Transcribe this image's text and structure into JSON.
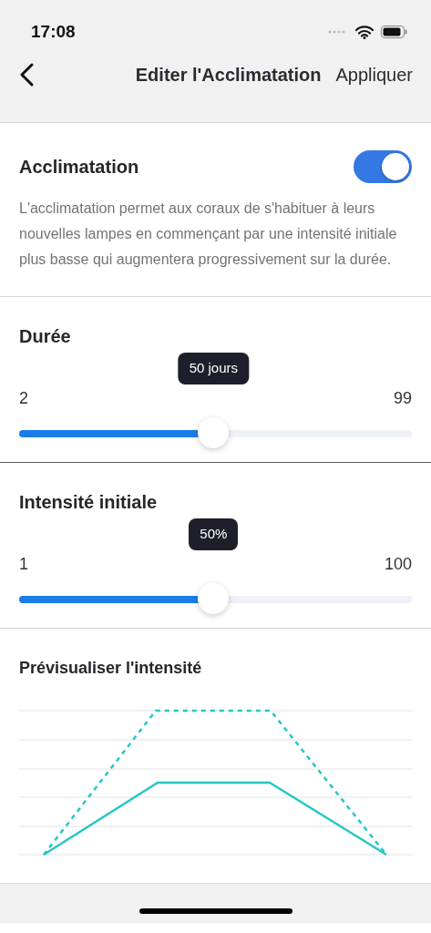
{
  "status_bar": {
    "time": "17:08"
  },
  "nav": {
    "title": "Editer l'Acclimatation",
    "action": "Appliquer"
  },
  "acclimatation": {
    "label": "Acclimatation",
    "on": true,
    "description": "L'acclimatation permet aux coraux de s'habituer à leurs nouvelles lampes en commençant par une intensité initiale plus basse qui augmentera progressivement sur la durée."
  },
  "sliders": [
    {
      "label": "Durée",
      "min": "2",
      "max": "99",
      "value": "50 jours",
      "level": 0.495
    },
    {
      "label": "Intensité initiale",
      "min": "1",
      "max": "100",
      "value": "50%",
      "level": 0.495
    }
  ],
  "preview": {
    "title": "Prévisualiser l'intensité"
  }
}
